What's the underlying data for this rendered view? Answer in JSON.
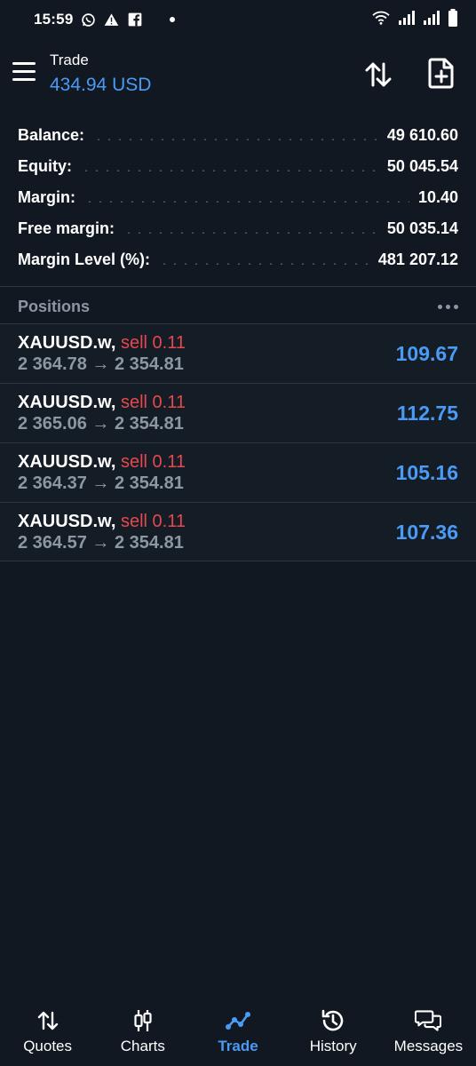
{
  "status_bar": {
    "time": "15:59",
    "left_icons": [
      "whatsapp-icon",
      "warning-icon",
      "facebook-icon"
    ],
    "right_icons": [
      "wifi-icon",
      "signal-icon",
      "signal-icon-2",
      "battery-icon"
    ]
  },
  "header": {
    "title": "Trade",
    "amount": "434.94 USD"
  },
  "summary": [
    {
      "label": "Balance:",
      "value": "49 610.60"
    },
    {
      "label": "Equity:",
      "value": "50 045.54"
    },
    {
      "label": "Margin:",
      "value": "10.40"
    },
    {
      "label": "Free margin:",
      "value": "50 035.14"
    },
    {
      "label": "Margin Level (%):",
      "value": "481 207.12"
    }
  ],
  "positions": {
    "title": "Positions",
    "items": [
      {
        "symbol": "XAUUSD.w,",
        "side": "sell 0.11",
        "prices": "2 364.78 → 2 354.81",
        "profit": "109.67"
      },
      {
        "symbol": "XAUUSD.w,",
        "side": "sell 0.11",
        "prices": "2 365.06 → 2 354.81",
        "profit": "112.75"
      },
      {
        "symbol": "XAUUSD.w,",
        "side": "sell 0.11",
        "prices": "2 364.37 → 2 354.81",
        "profit": "105.16"
      },
      {
        "symbol": "XAUUSD.w,",
        "side": "sell 0.11",
        "prices": "2 364.57 → 2 354.81",
        "profit": "107.36"
      }
    ]
  },
  "nav": [
    {
      "label": "Quotes",
      "icon": "quotes-arrows-icon"
    },
    {
      "label": "Charts",
      "icon": "candlestick-icon"
    },
    {
      "label": "Trade",
      "icon": "trade-line-icon",
      "active": true
    },
    {
      "label": "History",
      "icon": "history-clock-icon"
    },
    {
      "label": "Messages",
      "icon": "messages-bubbles-icon"
    }
  ],
  "colors": {
    "background": "#111821",
    "accent": "#4a9bf5",
    "sell": "#e5484d",
    "muted": "#8d97a3",
    "divider": "#2c3541"
  }
}
